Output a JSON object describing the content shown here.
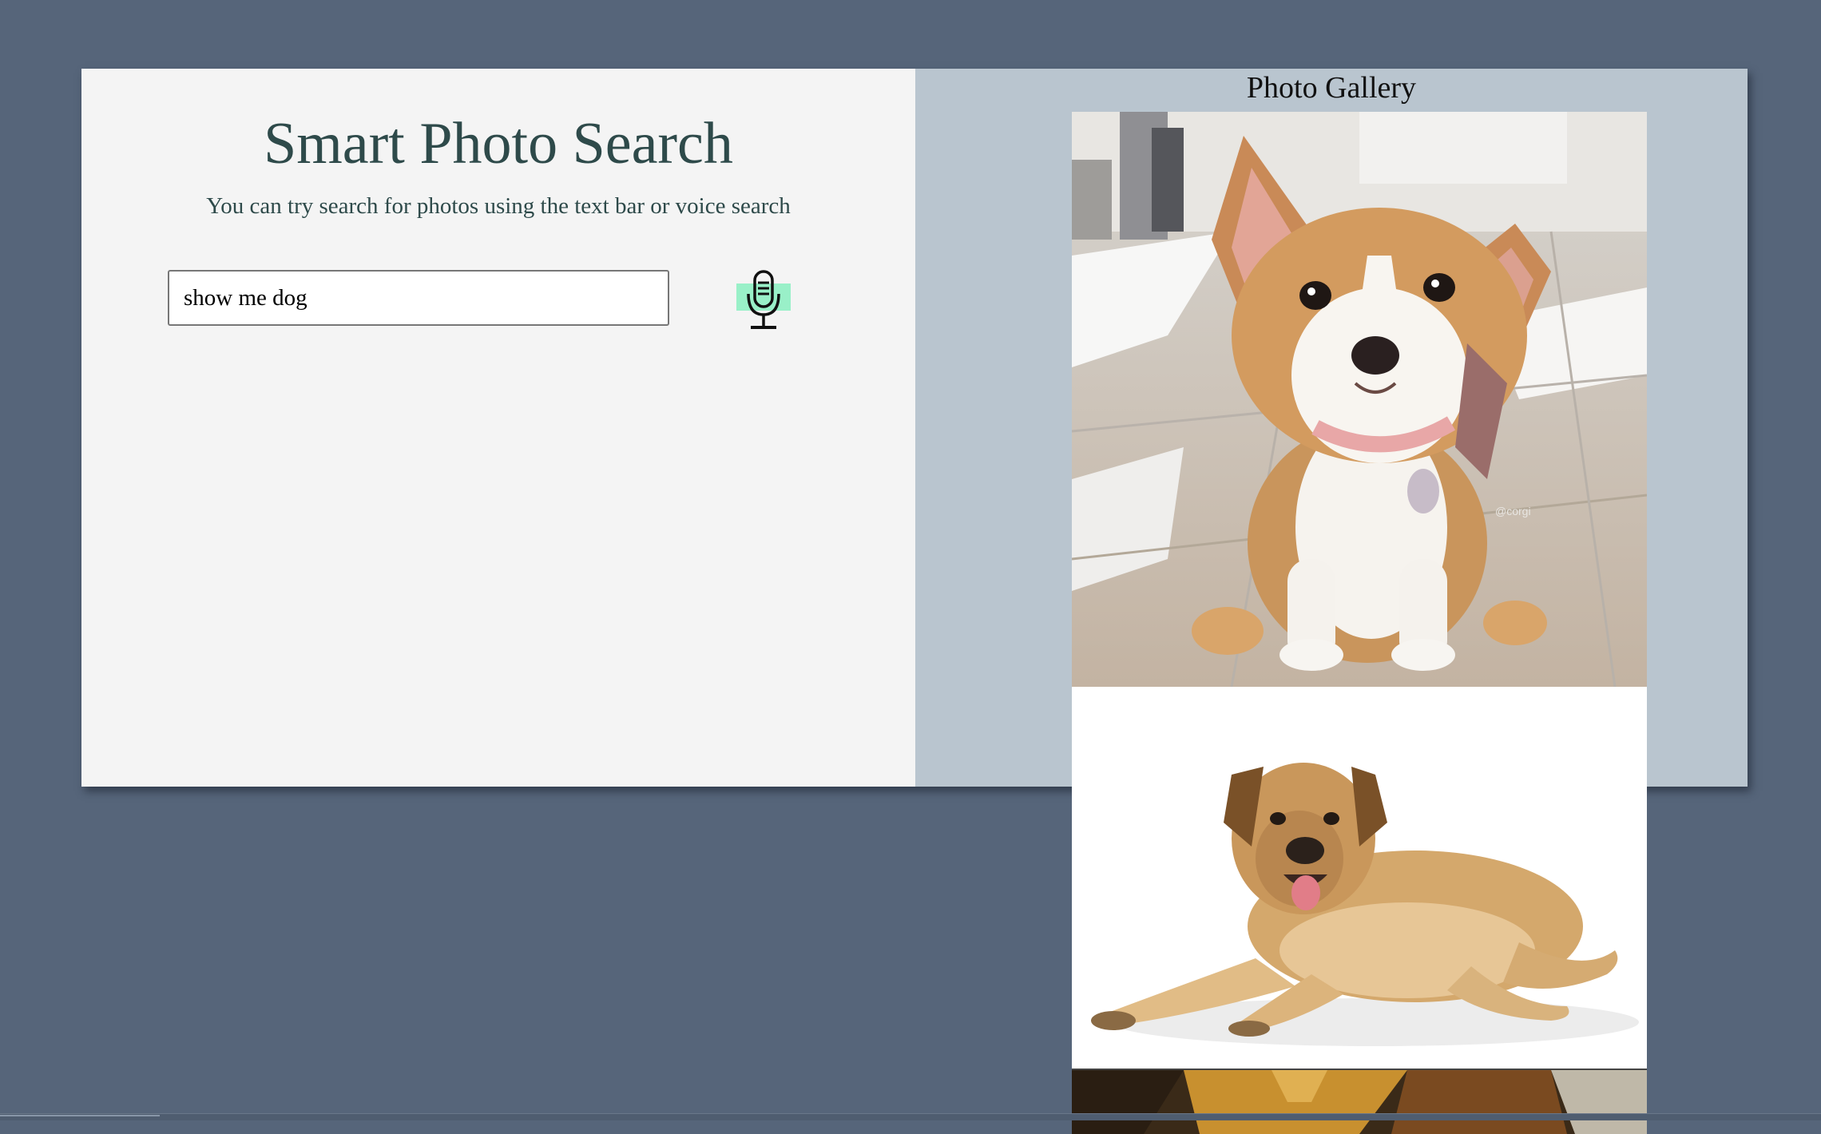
{
  "search": {
    "title": "Smart Photo Search",
    "subtitle": "You can try search for photos using the text bar or voice search",
    "query": "show me dog"
  },
  "voice": {
    "icon": "microphone-icon",
    "highlight_color": "#99f0c8"
  },
  "gallery": {
    "title": "Photo Gallery",
    "photos": [
      {
        "subject": "corgi-puppy"
      },
      {
        "subject": "lying-tan-dog"
      },
      {
        "subject": "dog-photo-partial"
      }
    ]
  },
  "colors": {
    "background": "#56657a",
    "left_panel": "#f4f4f4",
    "right_panel": "#b9c5cf",
    "heading_text": "#2e4a4a"
  }
}
